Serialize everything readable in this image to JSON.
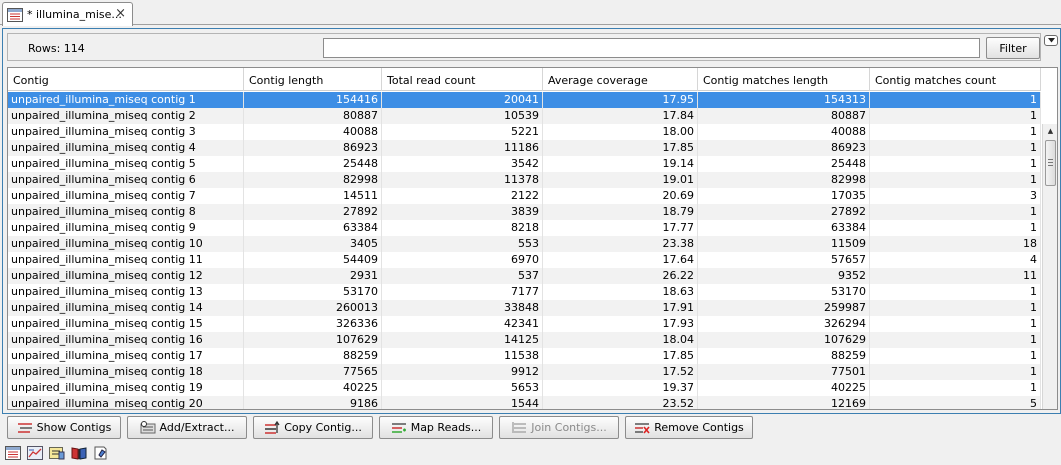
{
  "tab": {
    "title": "* illumina_mise...",
    "icon": "table-view-icon",
    "close_symbol": "×"
  },
  "filter_bar": {
    "rows_label": "Rows: 114",
    "input_value": "",
    "filter_button": "Filter"
  },
  "columns": [
    "Contig",
    "Contig length",
    "Total read count",
    "Average coverage",
    "Contig matches length",
    "Contig matches count"
  ],
  "rows": [
    [
      "unpaired_illumina_miseq contig 1",
      "154416",
      "20041",
      "17.95",
      "154313",
      "1"
    ],
    [
      "unpaired_illumina_miseq contig 2",
      "80887",
      "10539",
      "17.84",
      "80887",
      "1"
    ],
    [
      "unpaired_illumina_miseq contig 3",
      "40088",
      "5221",
      "18.00",
      "40088",
      "1"
    ],
    [
      "unpaired_illumina_miseq contig 4",
      "86923",
      "11186",
      "17.85",
      "86923",
      "1"
    ],
    [
      "unpaired_illumina_miseq contig 5",
      "25448",
      "3542",
      "19.14",
      "25448",
      "1"
    ],
    [
      "unpaired_illumina_miseq contig 6",
      "82998",
      "11378",
      "19.01",
      "82998",
      "1"
    ],
    [
      "unpaired_illumina_miseq contig 7",
      "14511",
      "2122",
      "20.69",
      "17035",
      "3"
    ],
    [
      "unpaired_illumina_miseq contig 8",
      "27892",
      "3839",
      "18.79",
      "27892",
      "1"
    ],
    [
      "unpaired_illumina_miseq contig 9",
      "63384",
      "8218",
      "17.77",
      "63384",
      "1"
    ],
    [
      "unpaired_illumina_miseq contig 10",
      "3405",
      "553",
      "23.38",
      "11509",
      "18"
    ],
    [
      "unpaired_illumina_miseq contig 11",
      "54409",
      "6970",
      "17.64",
      "57657",
      "4"
    ],
    [
      "unpaired_illumina_miseq contig 12",
      "2931",
      "537",
      "26.22",
      "9352",
      "11"
    ],
    [
      "unpaired_illumina_miseq contig 13",
      "53170",
      "7177",
      "18.63",
      "53170",
      "1"
    ],
    [
      "unpaired_illumina_miseq contig 14",
      "260013",
      "33848",
      "17.91",
      "259987",
      "1"
    ],
    [
      "unpaired_illumina_miseq contig 15",
      "326336",
      "42341",
      "17.93",
      "326294",
      "1"
    ],
    [
      "unpaired_illumina_miseq contig 16",
      "107629",
      "14125",
      "18.04",
      "107629",
      "1"
    ],
    [
      "unpaired_illumina_miseq contig 17",
      "88259",
      "11538",
      "17.85",
      "88259",
      "1"
    ],
    [
      "unpaired_illumina_miseq contig 18",
      "77565",
      "9912",
      "17.52",
      "77501",
      "1"
    ],
    [
      "unpaired_illumina_miseq contig 19",
      "40225",
      "5653",
      "19.37",
      "40225",
      "1"
    ],
    [
      "unpaired_illumina_miseq contig 20",
      "9186",
      "1544",
      "23.52",
      "12169",
      "5"
    ]
  ],
  "selected_row": 0,
  "actions": {
    "show_contigs": "Show Contigs",
    "add_extract": "Add/Extract...",
    "copy_contig": "Copy Contig...",
    "map_reads": "Map Reads...",
    "join_contigs": "Join Contigs...",
    "remove_contigs": "Remove Contigs"
  },
  "views": [
    "table-view-icon",
    "graph-view-icon",
    "report-view-icon",
    "book-view-icon",
    "history-view-icon"
  ],
  "colors": {
    "selection": "#3d8ee5",
    "frame": "#3c7fb1"
  }
}
